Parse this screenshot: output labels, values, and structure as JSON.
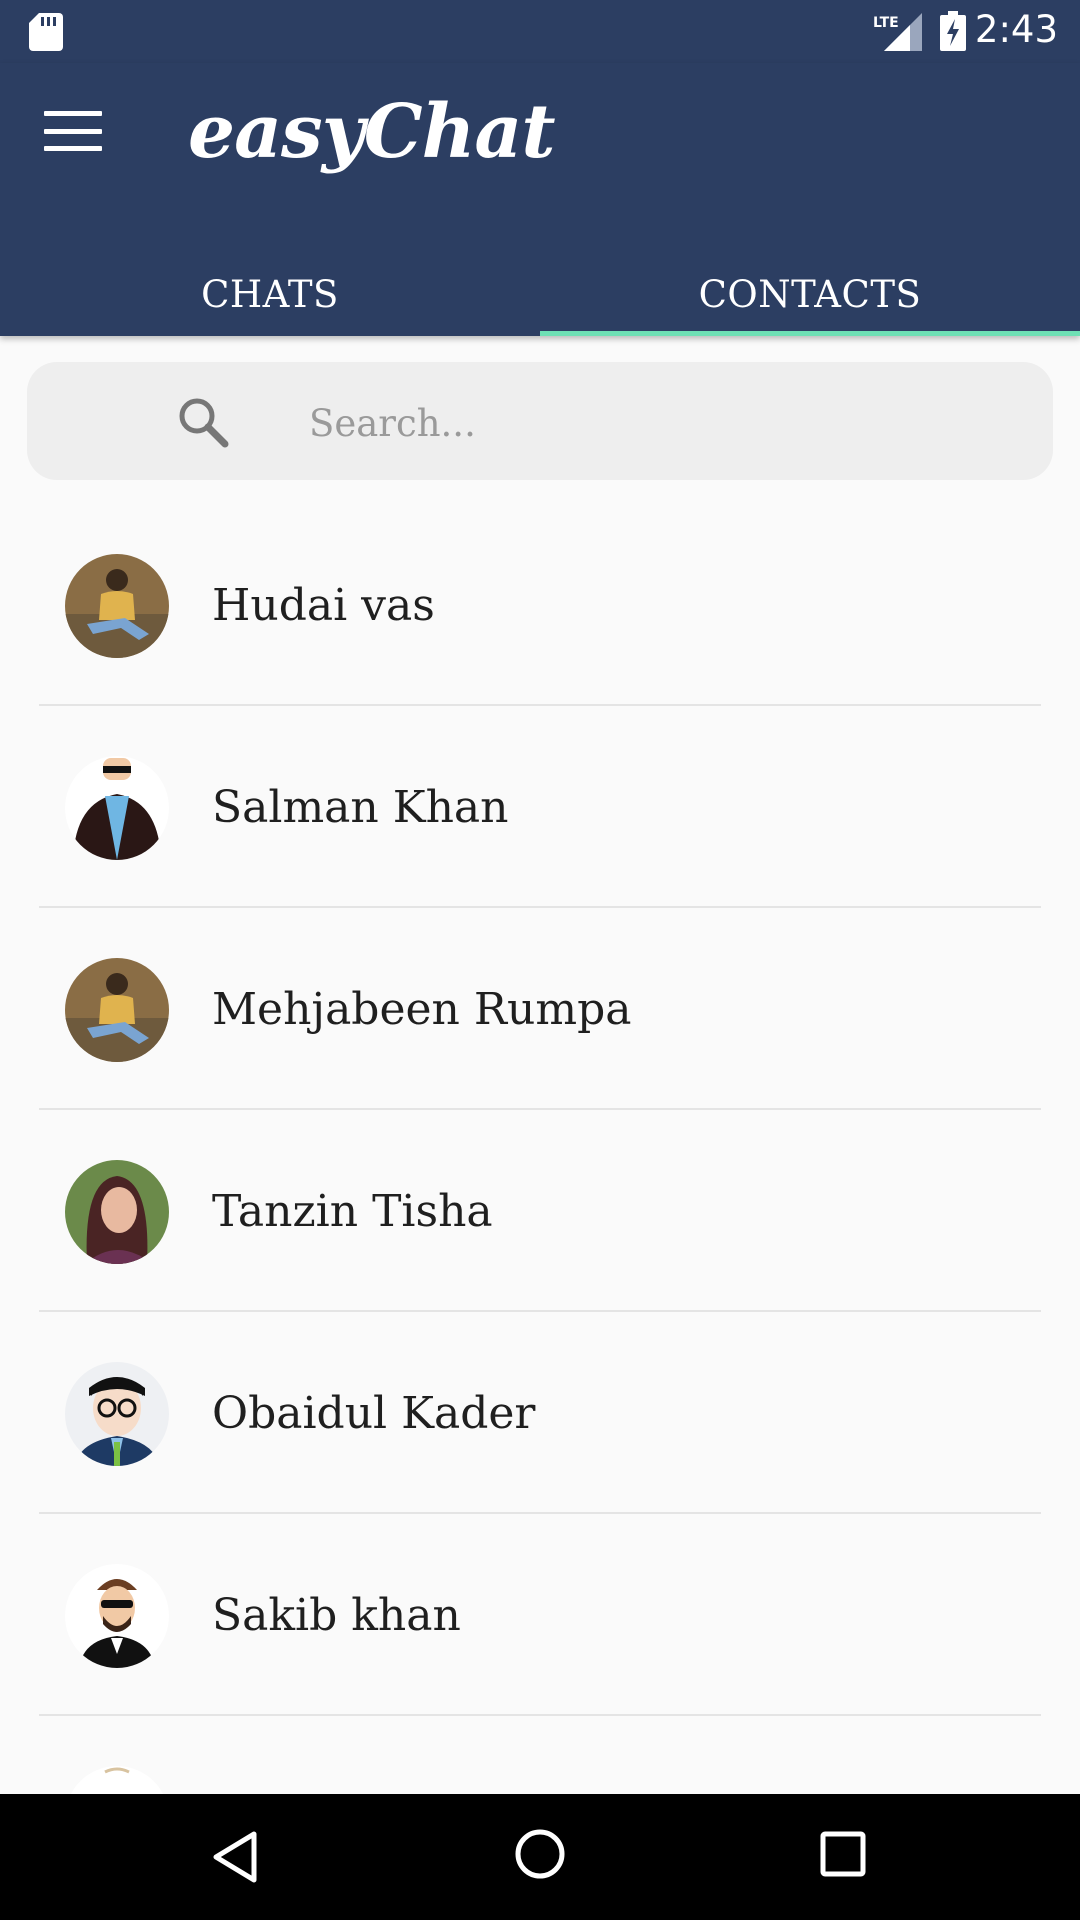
{
  "status_bar": {
    "time": "2:43",
    "network": "LTE",
    "icons": [
      "sd-card-icon",
      "lte-signal-icon",
      "battery-charging-icon"
    ]
  },
  "app": {
    "title": "easyChat",
    "menu_icon": "hamburger-menu-icon"
  },
  "tabs": [
    {
      "label": "CHATS",
      "active": false
    },
    {
      "label": "CONTACTS",
      "active": true
    }
  ],
  "search": {
    "placeholder": "Search...",
    "value": "",
    "icon": "search-icon"
  },
  "contacts": [
    {
      "name": "Hudai vas",
      "avatar": "photo-girl-sitting"
    },
    {
      "name": "Salman Khan",
      "avatar": "cartoon-man-sunglasses"
    },
    {
      "name": "Mehjabeen Rumpa",
      "avatar": "photo-girl-sitting"
    },
    {
      "name": "Tanzin Tisha",
      "avatar": "photo-woman-portrait"
    },
    {
      "name": "Obaidul Kader",
      "avatar": "cartoon-man-glasses"
    },
    {
      "name": "Sakib khan",
      "avatar": "cartoon-man-beard-sunglasses"
    }
  ],
  "colors": {
    "primary": "#2c3e62",
    "tab_indicator": "#6fe0b5",
    "background": "#fafafa",
    "search_bg": "#eeeeee"
  },
  "nav_bar": {
    "icons": [
      "back-icon",
      "home-icon",
      "recents-icon"
    ]
  }
}
